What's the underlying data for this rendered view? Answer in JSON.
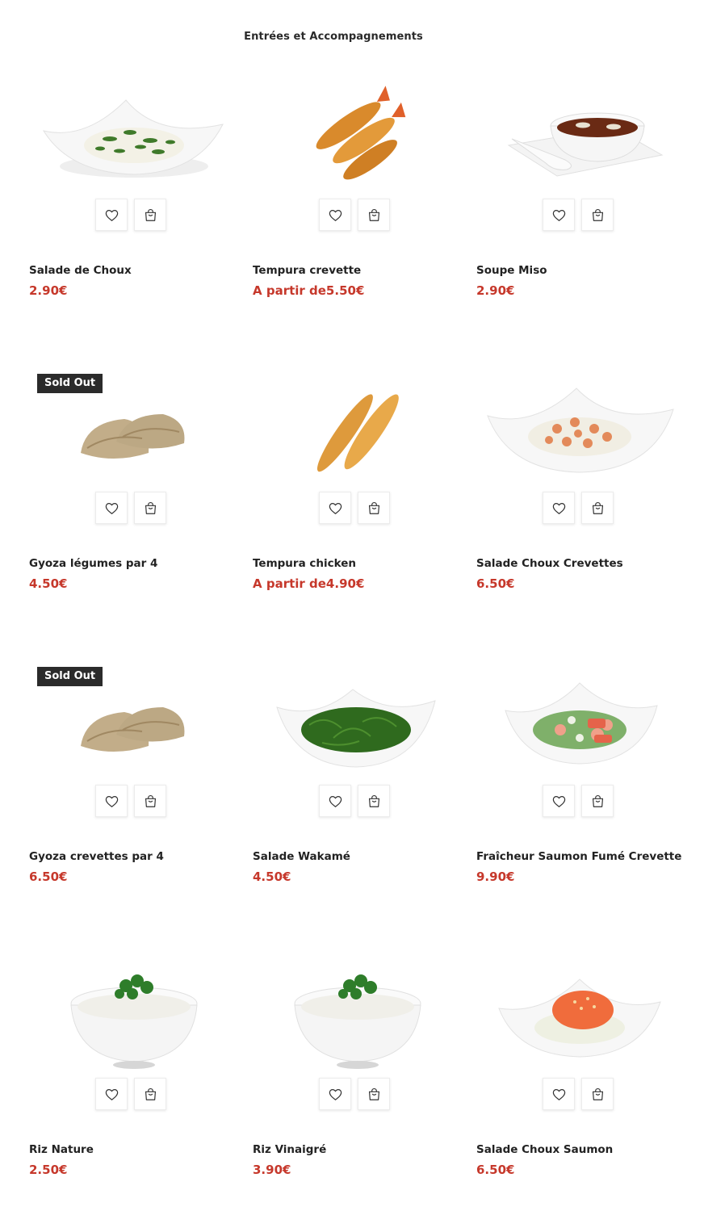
{
  "section": {
    "title": "Entrées et Accompagnements"
  },
  "badges": {
    "sold_out": "Sold Out"
  },
  "colors": {
    "price": "#c6382b",
    "badge_bg": "#2b2b2b"
  },
  "products": [
    {
      "name": "Salade de Choux",
      "price": "2.90€",
      "sold_out": false,
      "image": "cabbage-salad-dish"
    },
    {
      "name": "Tempura crevette",
      "price": "A partir de5.50€",
      "sold_out": false,
      "image": "tempura-shrimp"
    },
    {
      "name": "Soupe Miso",
      "price": "2.90€",
      "sold_out": false,
      "image": "miso-soup-bowl"
    },
    {
      "name": "Gyoza légumes par 4",
      "price": "4.50€",
      "sold_out": true,
      "image": "gyoza"
    },
    {
      "name": "Tempura chicken",
      "price": "A partir de4.90€",
      "sold_out": false,
      "image": "tempura-chicken"
    },
    {
      "name": "Salade Choux Crevettes",
      "price": "6.50€",
      "sold_out": false,
      "image": "cabbage-shrimp-salad"
    },
    {
      "name": "Gyoza crevettes par 4",
      "price": "6.50€",
      "sold_out": true,
      "image": "gyoza"
    },
    {
      "name": "Salade Wakamé",
      "price": "4.50€",
      "sold_out": false,
      "image": "wakame-salad"
    },
    {
      "name": "Fraîcheur Saumon Fumé Crevette",
      "price": "9.90€",
      "sold_out": false,
      "image": "salmon-shrimp-salad"
    },
    {
      "name": "Riz Nature",
      "price": "2.50€",
      "sold_out": false,
      "image": "rice-bowl"
    },
    {
      "name": "Riz Vinaigré",
      "price": "3.90€",
      "sold_out": false,
      "image": "rice-bowl"
    },
    {
      "name": "Salade Choux Saumon",
      "price": "6.50€",
      "sold_out": false,
      "image": "cabbage-salmon-salad"
    }
  ]
}
